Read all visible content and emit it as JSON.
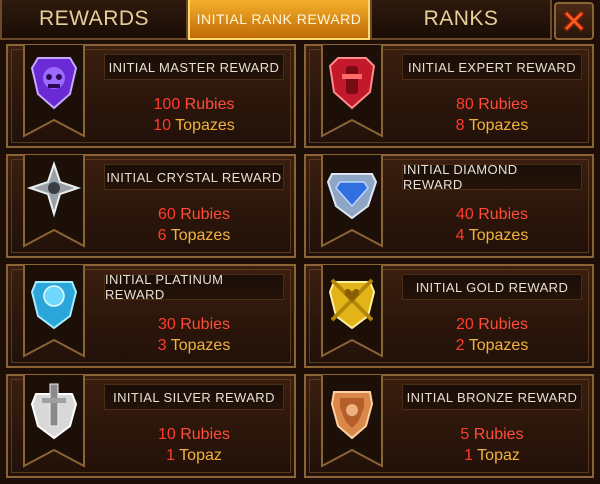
{
  "tabs": {
    "rewards": "REWARDS",
    "initial": "INITIAL RANK REWARD",
    "ranks": "RANKS"
  },
  "close_icon": "close-icon",
  "colors": {
    "active_tab": "#f4b02a",
    "rubies": "#ff4d3a",
    "topazes": "#f2b33c",
    "frame": "#8a6434"
  },
  "cards": [
    {
      "title": "INITIAL MASTER REWARD",
      "rubies_num": "100",
      "rubies_label": "Rubies",
      "topaz_num": "10",
      "topaz_label": "Topazes",
      "emblem": "master-emblem-icon"
    },
    {
      "title": "INITIAL EXPERT REWARD",
      "rubies_num": "80",
      "rubies_label": "Rubies",
      "topaz_num": "8",
      "topaz_label": "Topazes",
      "emblem": "expert-emblem-icon"
    },
    {
      "title": "INITIAL CRYSTAL REWARD",
      "rubies_num": "60",
      "rubies_label": "Rubies",
      "topaz_num": "6",
      "topaz_label": "Topazes",
      "emblem": "crystal-emblem-icon"
    },
    {
      "title": "INITIAL DIAMOND REWARD",
      "rubies_num": "40",
      "rubies_label": "Rubies",
      "topaz_num": "4",
      "topaz_label": "Topazes",
      "emblem": "diamond-emblem-icon"
    },
    {
      "title": "INITIAL PLATINUM REWARD",
      "rubies_num": "30",
      "rubies_label": "Rubies",
      "topaz_num": "3",
      "topaz_label": "Topazes",
      "emblem": "platinum-emblem-icon"
    },
    {
      "title": "INITIAL GOLD REWARD",
      "rubies_num": "20",
      "rubies_label": "Rubies",
      "topaz_num": "2",
      "topaz_label": "Topazes",
      "emblem": "gold-emblem-icon"
    },
    {
      "title": "INITIAL SILVER REWARD",
      "rubies_num": "10",
      "rubies_label": "Rubies",
      "topaz_num": "1",
      "topaz_label": "Topaz",
      "emblem": "silver-emblem-icon"
    },
    {
      "title": "INITIAL BRONZE REWARD",
      "rubies_num": "5",
      "rubies_label": "Rubies",
      "topaz_num": "1",
      "topaz_label": "Topaz",
      "emblem": "bronze-emblem-icon"
    }
  ]
}
